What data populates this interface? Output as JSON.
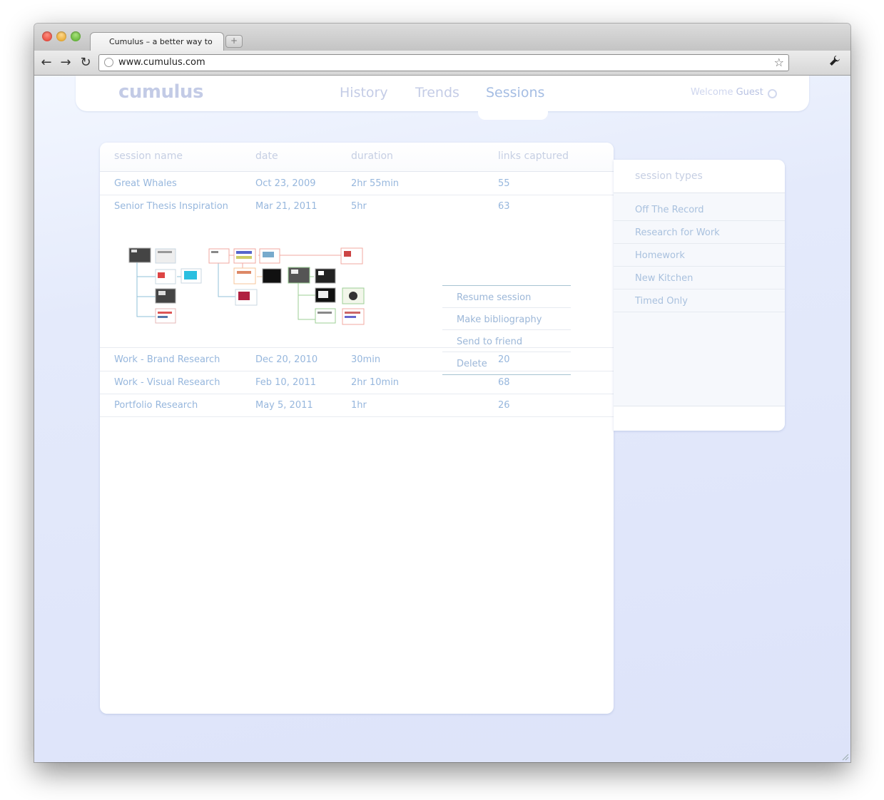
{
  "browser": {
    "tab_title": "Cumulus – a better way to",
    "new_tab_glyph": "+",
    "url": "www.cumulus.com",
    "icons": [
      "back-icon",
      "forward-icon",
      "reload-icon",
      "globe-icon",
      "bookmark-star-icon",
      "wrench-icon"
    ]
  },
  "header": {
    "logo": "cumulus",
    "nav": [
      "History",
      "Trends",
      "Sessions"
    ],
    "active_nav": "Sessions",
    "welcome_prefix": "Welcome",
    "welcome_user": "Guest"
  },
  "sessions": {
    "columns": [
      "session name",
      "date",
      "duration",
      "links captured"
    ],
    "rows": [
      {
        "name": "Great Whales",
        "date": "Oct 23, 2009",
        "duration": "2hr 55min",
        "links": "55"
      },
      {
        "name": "Senior Thesis Inspiration",
        "date": "Mar 21, 2011",
        "duration": "5hr",
        "links": "63"
      },
      {
        "name": "Work - Brand Research",
        "date": "Dec 20, 2010",
        "duration": "30min",
        "links": "20"
      },
      {
        "name": "Work - Visual Research",
        "date": "Feb 10, 2011",
        "duration": "2hr 10min",
        "links": "68"
      },
      {
        "name": "Portfolio Research",
        "date": "May 5, 2011",
        "duration": "1hr",
        "links": "26"
      }
    ],
    "actions": [
      "Resume session",
      "Make bibliography",
      "Send to friend",
      "Delete"
    ]
  },
  "session_types": {
    "title": "session types",
    "items": [
      "Off The Record",
      "Research for Work",
      "Homework",
      "New Kitchen",
      "Timed Only"
    ]
  },
  "colors": {
    "accent_text": "#97b7dd",
    "muted_header": "#c6cfe3",
    "background": "#e3e8fb"
  }
}
